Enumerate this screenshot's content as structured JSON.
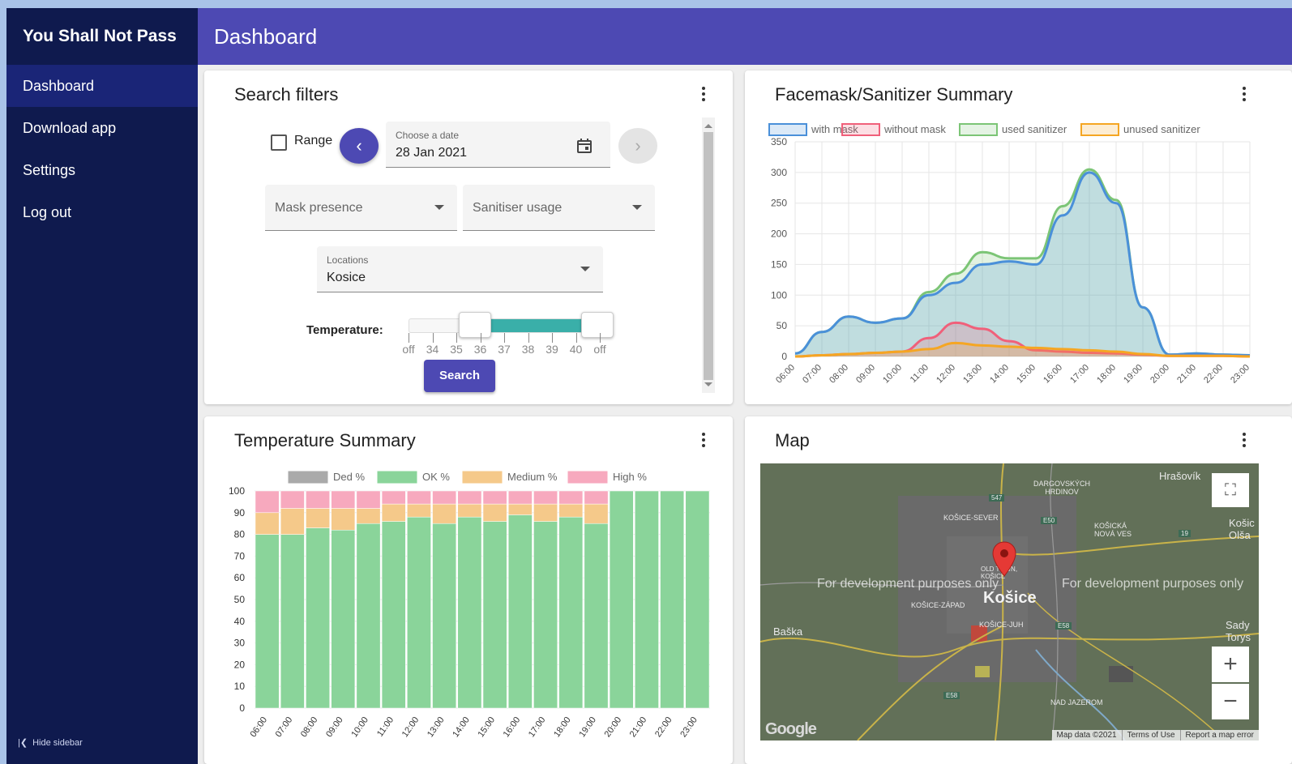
{
  "app": {
    "title": "You Shall Not Pass"
  },
  "sidebar": {
    "items": [
      {
        "label": "Dashboard"
      },
      {
        "label": "Download app"
      },
      {
        "label": "Settings"
      },
      {
        "label": "Log out"
      }
    ],
    "hide_label": "Hide sidebar"
  },
  "header": {
    "title": "Dashboard"
  },
  "filters": {
    "title": "Search filters",
    "range_label": "Range",
    "date_label": "Choose a date",
    "date_value": "28 Jan 2021",
    "mask_placeholder": "Mask presence",
    "sanitiser_placeholder": "Sanitiser usage",
    "locations_label": "Locations",
    "locations_value": "Kosice",
    "temperature_label": "Temperature:",
    "temperature_ticks": [
      "off",
      "34",
      "35",
      "36",
      "37",
      "38",
      "39",
      "40",
      "off"
    ],
    "temperature_range_fraction": [
      0.32,
      0.92
    ],
    "search_label": "Search"
  },
  "facemask": {
    "title": "Facemask/Sanitizer Summary"
  },
  "temperature": {
    "title": "Temperature Summary"
  },
  "map": {
    "title": "Map",
    "watermark": "For development purposes only",
    "city": "Košice",
    "labels": [
      "Hrašovík",
      "DARGOVSKÝCH HRDINOV",
      "KOŠICE-SEVER",
      "KOŠICKÁ NOVÁ VES",
      "OLD TOWN, KOŠICE",
      "KOŠICE-ZÁPAD",
      "KOŠICE-JUH",
      "Baška",
      "NAD JAZEROM",
      "Sady Torys",
      "Košic Olša"
    ],
    "roads": [
      "547",
      "E50",
      "19",
      "E58",
      "E58"
    ],
    "logo": "Google",
    "attribution": [
      "Map data ©2021",
      "Terms of Use",
      "Report a map error"
    ]
  },
  "chart_data": [
    {
      "type": "area",
      "title": "Facemask/Sanitizer Summary",
      "categories": [
        "06:00",
        "07:00",
        "08:00",
        "09:00",
        "10:00",
        "11:00",
        "12:00",
        "13:00",
        "14:00",
        "15:00",
        "16:00",
        "17:00",
        "18:00",
        "19:00",
        "20:00",
        "21:00",
        "22:00",
        "23:00"
      ],
      "ylim": [
        0,
        350
      ],
      "yticks": [
        0,
        50,
        100,
        150,
        200,
        250,
        300,
        350
      ],
      "legend_position": "top",
      "grid": true,
      "series": [
        {
          "name": "with mask",
          "color": "#4a90d9",
          "values": [
            5,
            40,
            65,
            55,
            62,
            100,
            120,
            150,
            155,
            150,
            230,
            300,
            250,
            80,
            3,
            5,
            3,
            2
          ]
        },
        {
          "name": "without mask",
          "color": "#f0607a",
          "values": [
            0,
            2,
            4,
            6,
            8,
            30,
            55,
            45,
            25,
            10,
            8,
            6,
            5,
            3,
            1,
            1,
            1,
            0
          ]
        },
        {
          "name": "used sanitizer",
          "color": "#7cc576",
          "values": [
            5,
            40,
            65,
            55,
            62,
            105,
            135,
            170,
            160,
            160,
            245,
            305,
            255,
            80,
            3,
            5,
            3,
            2
          ]
        },
        {
          "name": "unused sanitizer",
          "color": "#f5a623",
          "values": [
            0,
            2,
            4,
            6,
            8,
            12,
            22,
            18,
            16,
            14,
            12,
            10,
            8,
            4,
            1,
            1,
            1,
            0
          ]
        }
      ]
    },
    {
      "type": "bar",
      "stacked": true,
      "title": "Temperature Summary",
      "categories": [
        "06:00",
        "07:00",
        "08:00",
        "09:00",
        "10:00",
        "11:00",
        "12:00",
        "13:00",
        "14:00",
        "15:00",
        "16:00",
        "17:00",
        "18:00",
        "19:00",
        "20:00",
        "21:00",
        "22:00",
        "23:00"
      ],
      "ylim": [
        0,
        100
      ],
      "yticks": [
        0,
        10,
        20,
        30,
        40,
        50,
        60,
        70,
        80,
        90,
        100
      ],
      "legend_position": "top",
      "grid": true,
      "series": [
        {
          "name": "Ded %",
          "color": "#aaaaaa",
          "values": [
            0,
            0,
            0,
            0,
            0,
            0,
            0,
            0,
            0,
            0,
            0,
            0,
            0,
            0,
            0,
            0,
            0,
            0
          ]
        },
        {
          "name": "OK %",
          "color": "#8ad49a",
          "values": [
            80,
            80,
            83,
            82,
            85,
            86,
            88,
            85,
            88,
            86,
            89,
            86,
            88,
            85,
            100,
            100,
            100,
            100
          ]
        },
        {
          "name": "Medium %",
          "color": "#f5c98a",
          "values": [
            10,
            12,
            9,
            10,
            7,
            8,
            6,
            9,
            6,
            8,
            5,
            8,
            6,
            9,
            0,
            0,
            0,
            0
          ]
        },
        {
          "name": "High %",
          "color": "#f7a9be",
          "values": [
            10,
            8,
            8,
            8,
            8,
            6,
            6,
            6,
            6,
            6,
            6,
            6,
            6,
            6,
            0,
            0,
            0,
            0
          ]
        }
      ]
    }
  ]
}
